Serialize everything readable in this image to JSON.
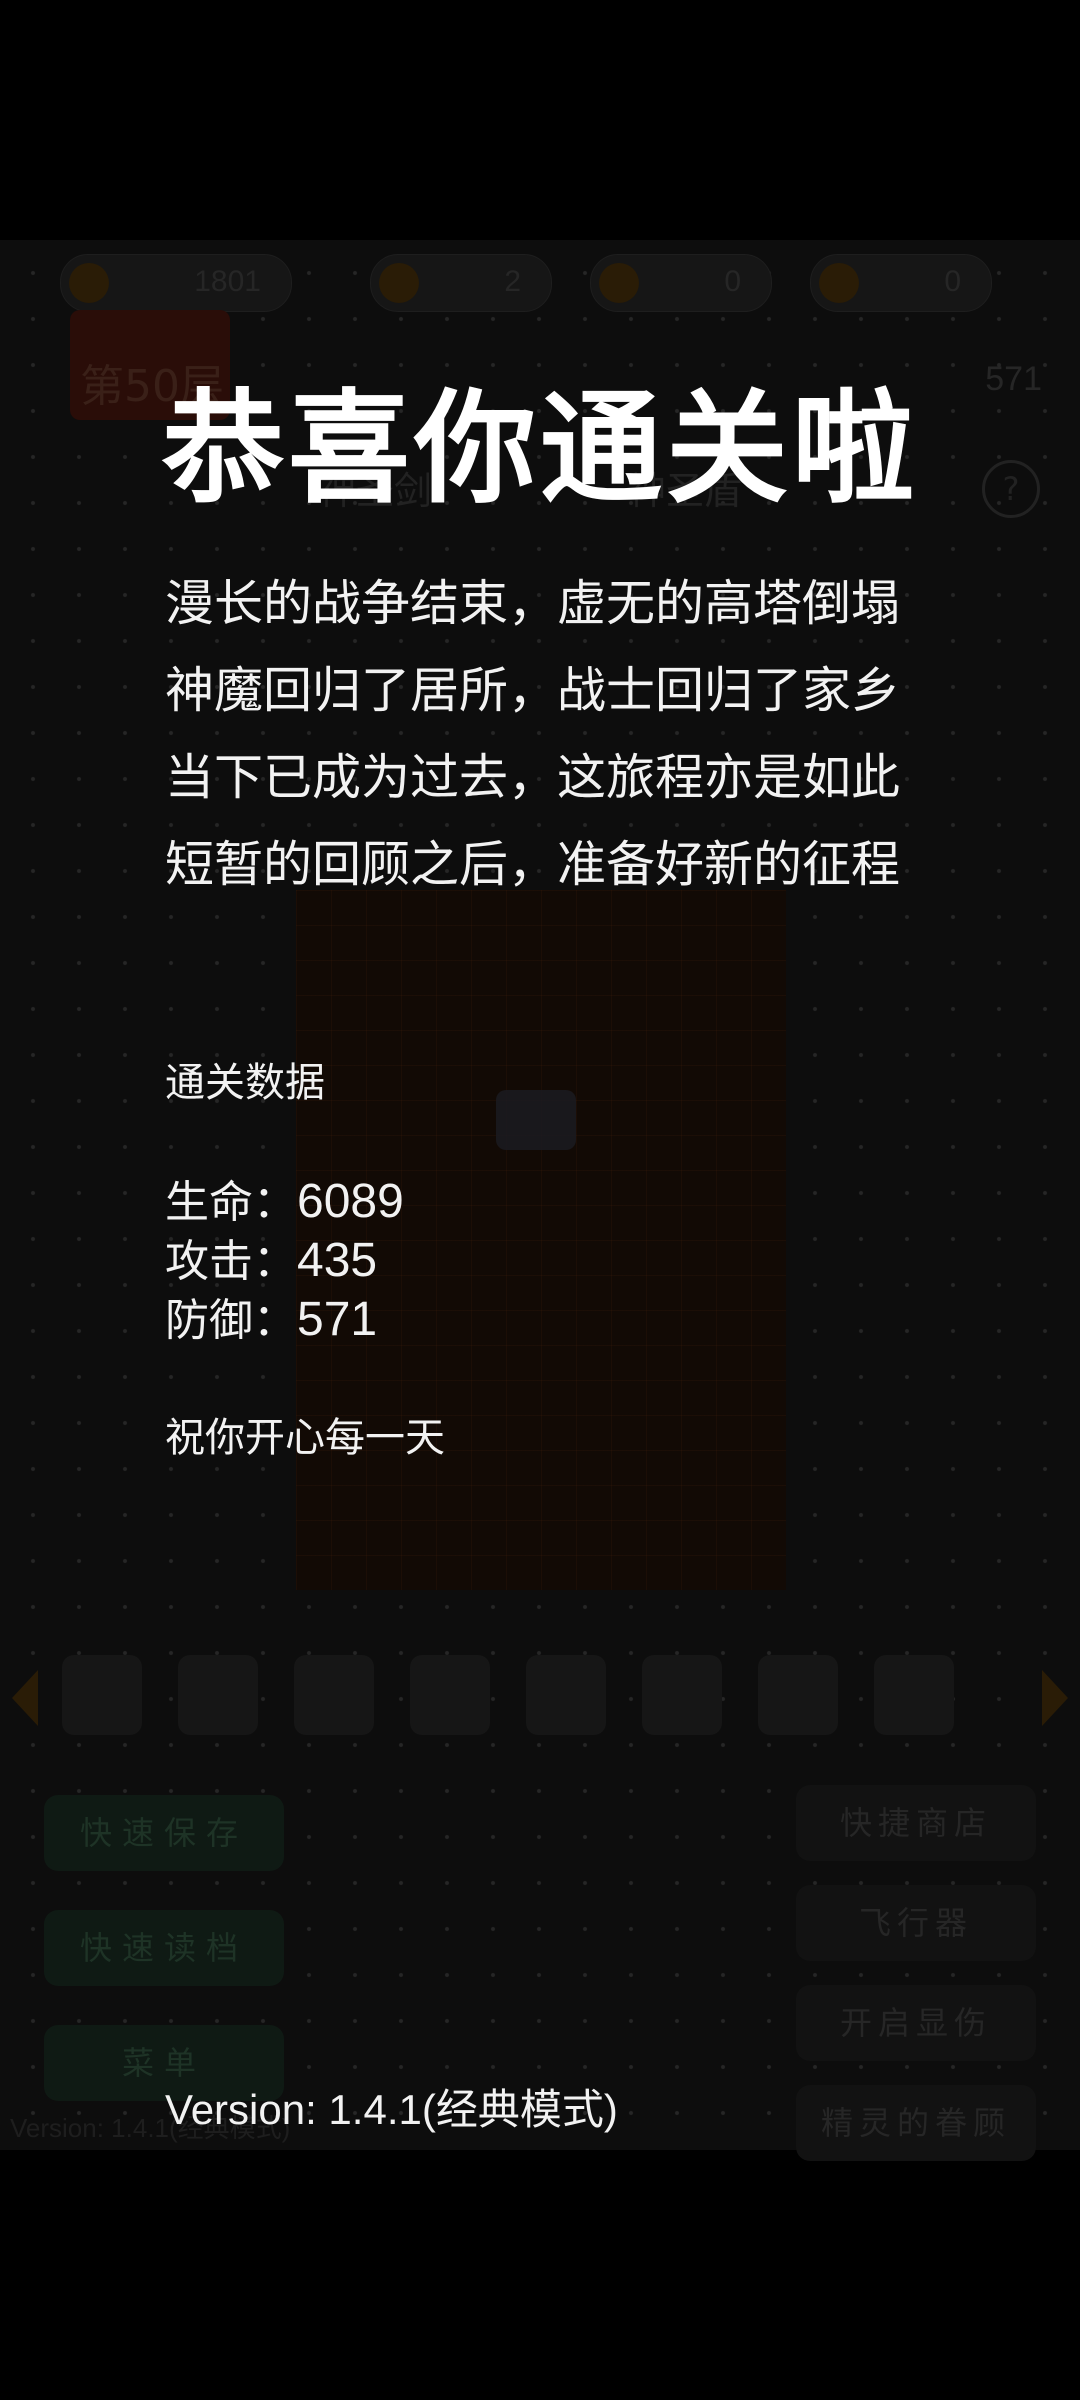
{
  "background": {
    "hud": {
      "gold": "1801",
      "key_yellow": "2",
      "key_blue": "0",
      "key_red": "0"
    },
    "floor_label": "第50层",
    "defense_mini": "571",
    "sword_label": "神圣剑",
    "shield_label": "神圣盾",
    "help_symbol": "?",
    "buttons_left": [
      "快速保存",
      "快速读档",
      "菜单"
    ],
    "buttons_right": [
      "快捷商店",
      "飞行器",
      "开启显伤",
      "精灵的眷顾"
    ],
    "version_text": "Version: 1.4.1(经典模式)"
  },
  "overlay": {
    "title": "恭喜你通关啦",
    "story_lines": [
      "漫长的战争结束，虚无的高塔倒塌",
      "神魔回归了居所，战士回归了家乡",
      "当下已成为过去，这旅程亦是如此",
      "短暂的回顾之后，准备好新的征程"
    ],
    "stats_heading": "通关数据",
    "stats": {
      "hp_label": "生命：",
      "hp_value": "6089",
      "atk_label": "攻击：",
      "atk_value": "435",
      "def_label": "防御：",
      "def_value": "571"
    },
    "wish": "祝你开心每一天",
    "version": "Version: 1.4.1(经典模式)"
  },
  "colors": {
    "background": "#000000",
    "text": "#ffffff"
  }
}
